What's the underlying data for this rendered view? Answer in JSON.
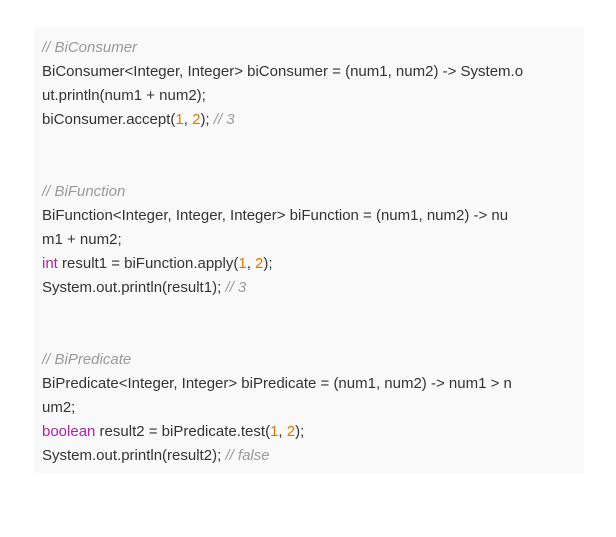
{
  "blocks": [
    {
      "comment": "// BiConsumer",
      "decl_line1": "BiConsumer<Integer, Integer> biConsumer = (num1, num2) -> System.o",
      "decl_line2": "ut.println(num1 + num2);",
      "call_prefix": "biConsumer.accept(",
      "arg1": "1",
      "sep": ", ",
      "arg2": "2",
      "call_suffix": "); ",
      "result_comment": "// 3"
    },
    {
      "comment": "// BiFunction",
      "decl_line1": "BiFunction<Integer, Integer, Integer> biFunction = (num1, num2) -> nu",
      "decl_line2": "m1 + num2;",
      "type_kw": "int",
      "assign_prefix": " result1 = biFunction.apply(",
      "arg1": "1",
      "sep": ", ",
      "arg2": "2",
      "assign_suffix": ");",
      "print_stmt": "System.out.println(result1); ",
      "result_comment": "// 3"
    },
    {
      "comment": "// BiPredicate",
      "decl_line1": "BiPredicate<Integer, Integer> biPredicate = (num1, num2) -> num1 > n",
      "decl_line2": "um2;",
      "type_kw": "boolean",
      "assign_prefix": " result2 = biPredicate.test(",
      "arg1": "1",
      "sep": ", ",
      "arg2": "2",
      "assign_suffix": ");",
      "print_stmt": "System.out.println(result2); ",
      "result_comment": "// false"
    }
  ],
  "colors": {
    "background": "#f9f9f9",
    "text": "#333333",
    "comment": "#999999",
    "number": "#d97a00",
    "keyword": "#a626a4"
  }
}
